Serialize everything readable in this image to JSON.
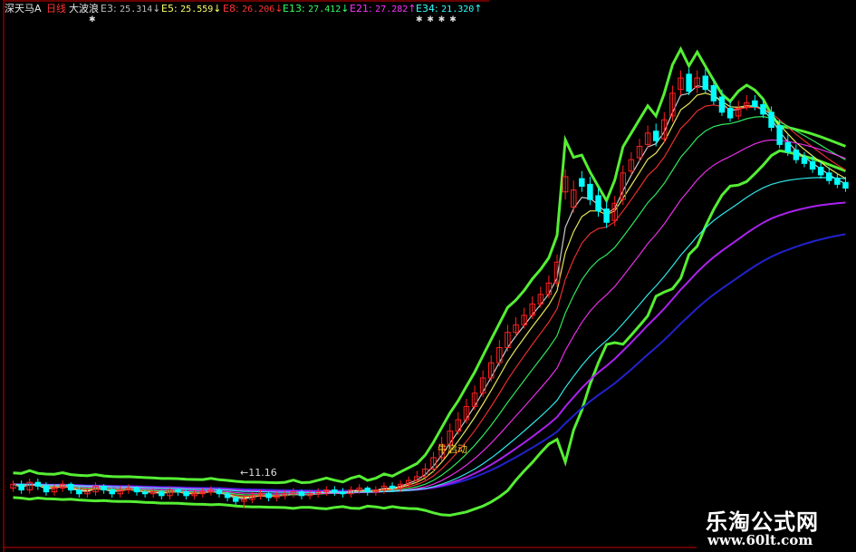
{
  "header": {
    "stock_name": "深天马A",
    "period": "日线",
    "indicator": "大波浪",
    "ma": [
      {
        "label": "E3:",
        "value": "25.314",
        "arrow": "↓",
        "color": "#e0e0e0"
      },
      {
        "label": "E5:",
        "value": "25.559",
        "arrow": "↓",
        "color": "#ffff66"
      },
      {
        "label": "E8:",
        "value": "26.206",
        "arrow": "↓",
        "color": "#ff3333"
      },
      {
        "label": "E13:",
        "value": "27.412",
        "arrow": "↓",
        "color": "#33ff66"
      },
      {
        "label": "E21:",
        "value": "27.282",
        "arrow": "↑",
        "color": "#ff33ff"
      },
      {
        "label": "E34:",
        "value": "21.320",
        "arrow": "↑",
        "color": "#33ffff"
      }
    ],
    "marks1": "✱",
    "marks2": "✱ ✱ ✱ ✱"
  },
  "annotations": {
    "start_signal": "牛启动",
    "low_price": "←11.16"
  },
  "watermark": {
    "site_name": "乐淘公式网",
    "url": "www.60lt.com"
  },
  "colors": {
    "up_candle": "#ff2020",
    "down_candle": "#00ffff",
    "band_green": "#55ee33",
    "blue_line": "#2222cc",
    "purple_line": "#aa22ee",
    "axis": "#cc0000"
  },
  "chart_data": {
    "type": "candlestick",
    "x": [
      1,
      2,
      3,
      4,
      5,
      6,
      7,
      8,
      9,
      10,
      11,
      12,
      13,
      14,
      15,
      16,
      17,
      18,
      19,
      20,
      21,
      22,
      23,
      24,
      25,
      26,
      27,
      28,
      29,
      30,
      31,
      32,
      33,
      34,
      35,
      36,
      37,
      38,
      39,
      40,
      41,
      42,
      43,
      44,
      45,
      46,
      47,
      48,
      49,
      50,
      51,
      52,
      53,
      54,
      55,
      56,
      57,
      58,
      59,
      60,
      61,
      62,
      63,
      64,
      65,
      66,
      67,
      68,
      69,
      70,
      71,
      72,
      73,
      74,
      75,
      76,
      77,
      78,
      79,
      80,
      81,
      82,
      83,
      84,
      85,
      86,
      87,
      88,
      89,
      90,
      91,
      92,
      93,
      94,
      95,
      96,
      97,
      98,
      99,
      100,
      101,
      102
    ],
    "open": [
      12.2,
      12.4,
      12.1,
      12.5,
      12.3,
      12.0,
      12.2,
      12.4,
      12.1,
      11.9,
      12.0,
      12.3,
      12.1,
      11.9,
      12.1,
      12.2,
      12.0,
      11.9,
      12.0,
      11.8,
      12.1,
      12.0,
      11.8,
      11.9,
      12.0,
      12.1,
      11.9,
      11.7,
      11.5,
      11.6,
      11.8,
      11.9,
      11.7,
      11.8,
      11.9,
      12.0,
      11.8,
      11.9,
      12.0,
      12.1,
      12.0,
      11.9,
      12.1,
      12.2,
      12.0,
      12.1,
      12.3,
      12.2,
      12.4,
      12.6,
      12.8,
      13.2,
      13.8,
      14.5,
      15.2,
      15.8,
      16.5,
      17.2,
      18.0,
      18.8,
      19.6,
      20.4,
      20.8,
      21.3,
      21.9,
      22.4,
      23.0,
      27.8,
      27.0,
      28.5,
      28.2,
      27.6,
      26.9,
      26.3,
      27.4,
      28.9,
      29.6,
      30.3,
      31.0,
      30.6,
      31.8,
      33.2,
      34.0,
      33.3,
      33.9,
      33.4,
      32.8,
      32.2,
      31.8,
      32.3,
      32.6,
      32.4,
      32.0,
      31.3,
      30.4,
      30.0,
      29.6,
      29.4,
      29.1,
      28.8,
      28.5,
      28.3
    ],
    "close": [
      12.4,
      12.1,
      12.5,
      12.3,
      12.0,
      12.2,
      12.4,
      12.1,
      11.9,
      12.0,
      12.3,
      12.1,
      11.9,
      12.1,
      12.2,
      12.0,
      11.9,
      12.0,
      11.8,
      12.1,
      12.0,
      11.8,
      11.9,
      12.0,
      12.1,
      11.9,
      11.7,
      11.5,
      11.6,
      11.8,
      11.9,
      11.7,
      11.8,
      11.9,
      12.0,
      11.8,
      11.9,
      12.0,
      12.1,
      12.0,
      11.9,
      12.1,
      12.2,
      12.0,
      12.1,
      12.3,
      12.2,
      12.4,
      12.6,
      12.8,
      13.2,
      13.8,
      14.5,
      15.2,
      15.8,
      16.5,
      17.2,
      18.0,
      18.8,
      19.6,
      20.4,
      20.8,
      21.3,
      21.9,
      22.4,
      23.0,
      24.1,
      28.6,
      27.9,
      28.1,
      27.4,
      26.8,
      26.2,
      27.2,
      28.8,
      29.5,
      30.2,
      30.9,
      30.5,
      31.6,
      33.0,
      33.8,
      33.1,
      33.8,
      33.2,
      32.6,
      32.0,
      31.7,
      32.2,
      32.5,
      32.3,
      31.9,
      31.2,
      30.3,
      29.9,
      29.5,
      29.3,
      29.0,
      28.7,
      28.4,
      28.2,
      28.0
    ],
    "high": [
      12.6,
      12.6,
      12.7,
      12.7,
      12.5,
      12.4,
      12.6,
      12.5,
      12.3,
      12.2,
      12.5,
      12.4,
      12.2,
      12.3,
      12.4,
      12.3,
      12.1,
      12.2,
      12.1,
      12.3,
      12.2,
      12.1,
      12.1,
      12.2,
      12.3,
      12.2,
      12.0,
      11.8,
      11.8,
      12.0,
      12.1,
      12.0,
      12.0,
      12.1,
      12.2,
      12.1,
      12.1,
      12.2,
      12.3,
      12.3,
      12.2,
      12.3,
      12.4,
      12.3,
      12.3,
      12.5,
      12.5,
      12.6,
      12.8,
      13.1,
      13.5,
      14.1,
      14.9,
      15.6,
      16.2,
      16.9,
      17.6,
      18.4,
      19.2,
      20.0,
      20.8,
      21.2,
      21.7,
      22.3,
      22.8,
      23.4,
      24.5,
      29.0,
      28.4,
      28.9,
      28.6,
      28.0,
      27.3,
      27.6,
      29.2,
      29.9,
      30.6,
      31.3,
      31.4,
      32.0,
      33.4,
      34.2,
      34.3,
      34.2,
      34.3,
      33.8,
      33.2,
      32.6,
      32.6,
      32.9,
      32.9,
      32.7,
      32.3,
      31.6,
      30.8,
      30.3,
      29.9,
      29.7,
      29.4,
      29.1,
      28.8,
      28.6
    ],
    "low": [
      12.0,
      11.9,
      11.9,
      12.1,
      11.8,
      11.8,
      12.0,
      11.9,
      11.7,
      11.7,
      11.8,
      11.9,
      11.7,
      11.7,
      11.9,
      11.8,
      11.7,
      11.7,
      11.6,
      11.6,
      11.8,
      11.6,
      11.6,
      11.7,
      11.8,
      11.7,
      11.5,
      11.3,
      11.16,
      11.4,
      11.6,
      11.5,
      11.5,
      11.6,
      11.7,
      11.6,
      11.6,
      11.7,
      11.8,
      11.8,
      11.7,
      11.7,
      11.9,
      11.8,
      11.8,
      11.9,
      12.0,
      12.0,
      12.2,
      12.4,
      12.6,
      13.0,
      13.6,
      14.3,
      15.0,
      15.6,
      16.3,
      17.0,
      17.8,
      18.6,
      19.4,
      20.2,
      20.6,
      21.1,
      21.7,
      22.2,
      22.8,
      27.4,
      26.7,
      27.8,
      27.1,
      26.5,
      25.9,
      26.0,
      27.1,
      28.7,
      29.4,
      30.1,
      30.2,
      30.4,
      31.5,
      32.9,
      32.9,
      33.0,
      33.0,
      32.4,
      31.8,
      31.5,
      31.6,
      32.1,
      32.1,
      31.7,
      31.0,
      30.1,
      29.7,
      29.3,
      29.1,
      28.8,
      28.5,
      28.2,
      28.0,
      27.8
    ],
    "ma_labels": [
      "E3",
      "E5",
      "E8",
      "E13",
      "E21",
      "E34"
    ],
    "y_range": [
      9.5,
      36
    ],
    "grid": false
  }
}
